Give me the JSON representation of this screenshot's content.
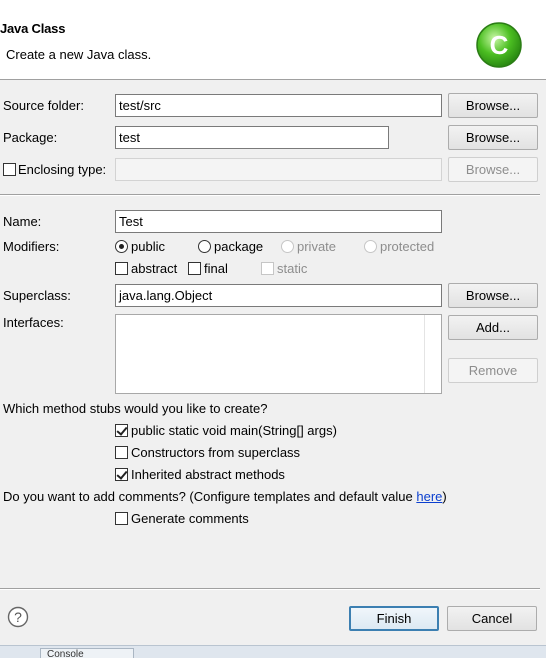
{
  "header": {
    "title": "Java Class",
    "subtitle": "Create a new Java class."
  },
  "source_folder": {
    "label": "Source folder:",
    "value": "test/src",
    "browse": "Browse..."
  },
  "package": {
    "label": "Package:",
    "value": "test",
    "browse": "Browse..."
  },
  "enclosing_type": {
    "label": "Enclosing type:",
    "checked": false,
    "value": "",
    "browse": "Browse..."
  },
  "name": {
    "label": "Name:",
    "value": "Test"
  },
  "modifiers": {
    "label": "Modifiers:",
    "access": [
      {
        "label": "public",
        "checked": true,
        "enabled": true
      },
      {
        "label": "package",
        "checked": false,
        "enabled": true
      },
      {
        "label": "private",
        "checked": false,
        "enabled": false
      },
      {
        "label": "protected",
        "checked": false,
        "enabled": false
      }
    ],
    "abstract": {
      "label": "abstract",
      "checked": false
    },
    "final": {
      "label": "final",
      "checked": false
    },
    "static": {
      "label": "static",
      "checked": false,
      "enabled": false
    }
  },
  "superclass": {
    "label": "Superclass:",
    "value": "java.lang.Object",
    "browse": "Browse..."
  },
  "interfaces": {
    "label": "Interfaces:",
    "add": "Add...",
    "remove": "Remove"
  },
  "stubs": {
    "question": "Which method stubs would you like to create?",
    "main": {
      "label": "public static void main(String[] args)",
      "checked": true
    },
    "constructors": {
      "label": "Constructors from superclass",
      "checked": false
    },
    "inherited": {
      "label": "Inherited abstract methods",
      "checked": true
    }
  },
  "comments": {
    "question_prefix": "Do you want to add comments? (Configure templates and default value ",
    "link": "here",
    "question_suffix": ")",
    "generate": {
      "label": "Generate comments",
      "checked": false
    }
  },
  "footer": {
    "finish": "Finish",
    "cancel": "Cancel"
  },
  "taskbar": {
    "tab_label": "Console"
  },
  "icons": {
    "class_icon_color": "#3fae1c",
    "help_icon": "help-icon"
  }
}
